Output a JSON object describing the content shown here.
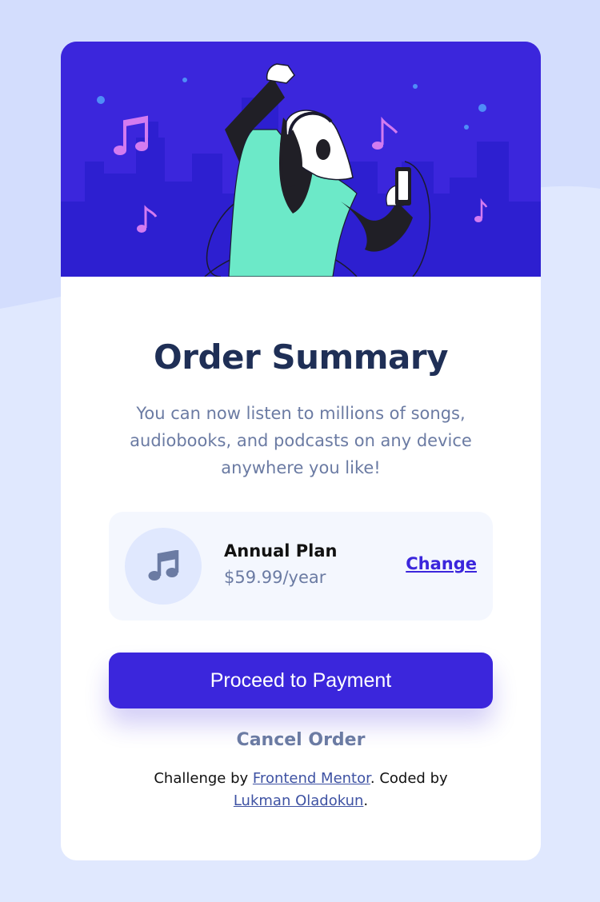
{
  "colors": {
    "page_bg": "#e0e8fe",
    "hero_bg": "#3b26dc",
    "accent": "#3b26dc",
    "heading": "#1f2f56",
    "muted": "#6b7ba3",
    "plan_bg": "#f4f7fe"
  },
  "hero": {
    "illustration": "dancing-person-with-headphones"
  },
  "summary": {
    "title": "Order Summary",
    "description": "You can now listen to millions of songs, audiobooks, and podcasts on any device anywhere you like!"
  },
  "plan": {
    "icon": "music-note-icon",
    "name": "Annual Plan",
    "price": "$59.99/year",
    "change_label": "Change"
  },
  "actions": {
    "pay_label": "Proceed to Payment",
    "cancel_label": "Cancel Order"
  },
  "attribution": {
    "prefix": "Challenge by",
    "link1": "Frontend Mentor",
    "middle": ". Coded by",
    "link2": "Lukman Oladokun",
    "suffix": "."
  }
}
